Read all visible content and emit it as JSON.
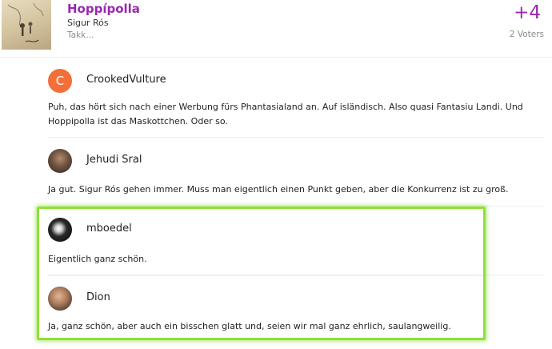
{
  "song": {
    "title": "Hoppípolla",
    "artist": "Sigur Rós",
    "album": "Takk...",
    "score": "+4",
    "voters": "2 Voters"
  },
  "comments": [
    {
      "username": "CrookedVulture",
      "avatar_letter": "C",
      "avatar_color": "#f26f3a",
      "text": "Puh, das hört sich nach einer Werbung fürs Phantasialand an. Auf isländisch. Also quasi Fantasiu Landi. Und Hoppipolla ist das Maskottchen. Oder so."
    },
    {
      "username": "Jehudi Sral",
      "text": "Ja gut. Sigur Rós gehen immer. Muss man eigentlich einen Punkt geben, aber die Konkurrenz ist zu groß."
    },
    {
      "username": "mboedel",
      "text": "Eigentlich ganz schön."
    },
    {
      "username": "Dion",
      "text": "Ja, ganz schön, aber auch ein bisschen glatt und, seien wir mal ganz ehrlich, saulangweilig."
    }
  ],
  "colors": {
    "accent": "#9b27b0",
    "highlight": "#8ee03a",
    "muted": "#8a8a8a"
  }
}
